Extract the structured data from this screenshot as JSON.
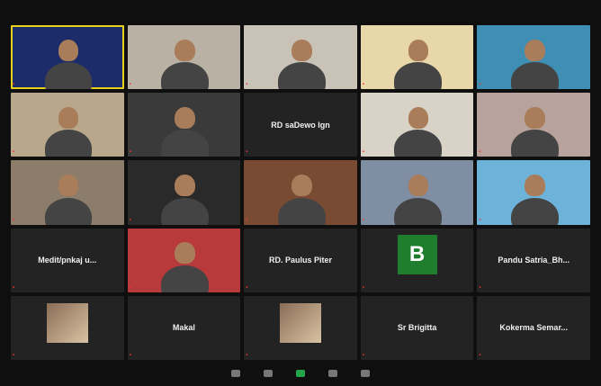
{
  "meeting": {
    "tiles": [
      {
        "name": "",
        "type": "video",
        "active": true,
        "bg": "#1c2c6a"
      },
      {
        "name": "",
        "type": "video",
        "bg": "#b9b2a4"
      },
      {
        "name": "",
        "type": "video",
        "bg": "#c9c2b6"
      },
      {
        "name": "",
        "type": "video",
        "bg": "#e8d7a8"
      },
      {
        "name": "",
        "type": "video",
        "bg": "#3f8fb5"
      },
      {
        "name": "",
        "type": "video",
        "bg": "#b9a78c"
      },
      {
        "name": "",
        "type": "video",
        "bg": "#3a3a3a"
      },
      {
        "name": "RD saDewo Ign",
        "type": "label",
        "bg": "#232323"
      },
      {
        "name": "",
        "type": "video",
        "bg": "#d9d2c7"
      },
      {
        "name": "",
        "type": "video",
        "bg": "#b7a39b"
      },
      {
        "name": "",
        "type": "video",
        "bg": "#8c7d6b"
      },
      {
        "name": "",
        "type": "video",
        "bg": "#2a2a2a"
      },
      {
        "name": "",
        "type": "video",
        "bg": "#7a4b33"
      },
      {
        "name": "",
        "type": "video",
        "bg": "#7f8ea3"
      },
      {
        "name": "",
        "type": "video",
        "bg": "#6db3d9"
      },
      {
        "name": "Medit/pnkaj  u...",
        "type": "label",
        "bg": "#232323"
      },
      {
        "name": "",
        "type": "video",
        "bg": "#b83a3a"
      },
      {
        "name": "RD. Paulus Piter",
        "type": "label",
        "bg": "#232323"
      },
      {
        "name": "",
        "type": "avatar",
        "letter": "B",
        "bg": "#232323"
      },
      {
        "name": "Pandu Satria_Bh...",
        "type": "label",
        "bg": "#232323"
      },
      {
        "name": "",
        "type": "photo",
        "bg": "#232323"
      },
      {
        "name": "Makal",
        "type": "label",
        "bg": "#232323"
      },
      {
        "name": "",
        "type": "photo",
        "bg": "#232323"
      },
      {
        "name": "Sr Brigitta",
        "type": "label",
        "bg": "#232323"
      },
      {
        "name": "Kokerma Semar...",
        "type": "label",
        "bg": "#232323"
      }
    ]
  },
  "toolbar": {
    "items": [
      {
        "label": "",
        "icon": "participants-icon"
      },
      {
        "label": "",
        "icon": "chat-icon"
      },
      {
        "label": "",
        "icon": "share-screen-icon",
        "green": true
      },
      {
        "label": "",
        "icon": "record-icon"
      },
      {
        "label": "",
        "icon": "reactions-icon"
      }
    ]
  }
}
